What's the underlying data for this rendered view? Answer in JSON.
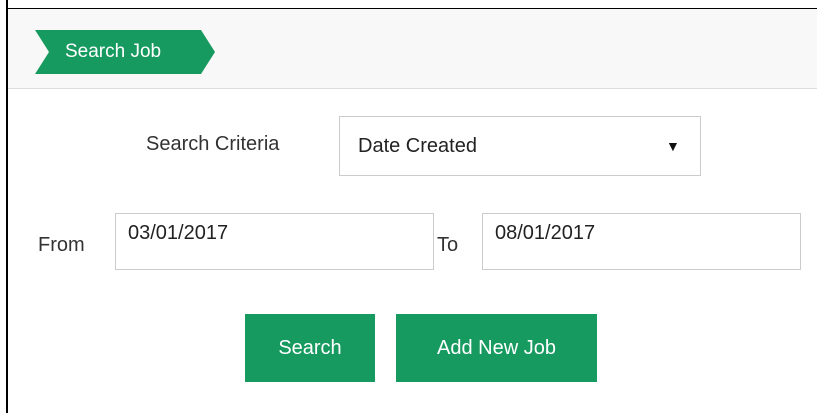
{
  "panel": {
    "title": "Search Job"
  },
  "form": {
    "criteria_label": "Search Criteria",
    "criteria_value": "Date Created",
    "criteria_caret": "▼",
    "from_label": "From",
    "from_value": "03/01/2017",
    "to_label": "To",
    "to_value": "08/01/2017"
  },
  "actions": {
    "search_label": "Search",
    "add_label": "Add New Job"
  },
  "colors": {
    "accent": "#179a60",
    "header_bg": "#f8f8f8",
    "border": "#cccccc"
  }
}
